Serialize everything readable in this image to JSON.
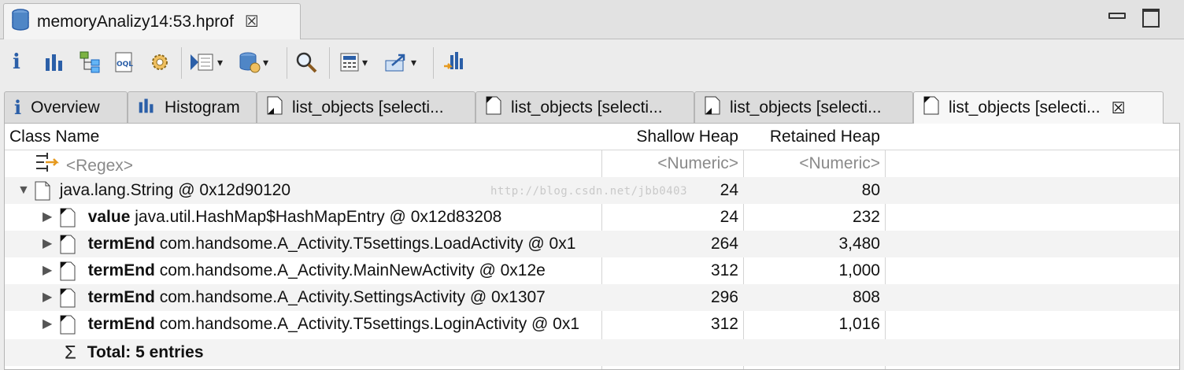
{
  "editor": {
    "tab_title": "memoryAnalizy14:53.hprof"
  },
  "toolbar": {
    "items": [
      "info-icon",
      "histogram-icon",
      "dominator-tree-icon",
      "oql-icon",
      "heap-dump-overview-icon",
      "run-expert-report-icon",
      "query-browser-icon",
      "search-icon",
      "calculate-retained-icon",
      "export-icon",
      "group-by-icon"
    ]
  },
  "result_tabs": [
    {
      "label": "Overview"
    },
    {
      "label": "Histogram"
    },
    {
      "label": "list_objects [selecti..."
    },
    {
      "label": "list_objects [selecti..."
    },
    {
      "label": "list_objects [selecti..."
    },
    {
      "label": "list_objects [selecti..."
    }
  ],
  "table": {
    "columns": [
      "Class Name",
      "Shallow Heap",
      "Retained Heap"
    ],
    "filter_row": {
      "name": "<Regex>",
      "shallow": "<Numeric>",
      "retained": "<Numeric>"
    },
    "root": {
      "name": "java.lang.String @ 0x12d90120",
      "shallow": "24",
      "retained": "80"
    },
    "children": [
      {
        "field": "value",
        "ref": "java.util.HashMap$HashMapEntry @ 0x12d83208",
        "shallow": "24",
        "retained": "232"
      },
      {
        "field": "termEnd",
        "ref": "com.handsome.A_Activity.T5settings.LoadActivity @ 0x1",
        "shallow": "264",
        "retained": "3,480"
      },
      {
        "field": "termEnd",
        "ref": "com.handsome.A_Activity.MainNewActivity @ 0x12e",
        "shallow": "312",
        "retained": "1,000"
      },
      {
        "field": "termEnd",
        "ref": "com.handsome.A_Activity.SettingsActivity @ 0x1307",
        "shallow": "296",
        "retained": "808"
      },
      {
        "field": "termEnd",
        "ref": "com.handsome.A_Activity.T5settings.LoginActivity @ 0x1",
        "shallow": "312",
        "retained": "1,016"
      }
    ],
    "total": "Total: 5 entries"
  },
  "watermark": "http://blog.csdn.net/jbb0403",
  "colors": {
    "icon_blue": "#2b5fa8",
    "tab_active": "#f7f7f7",
    "row_alt": "#f3f3f3"
  }
}
